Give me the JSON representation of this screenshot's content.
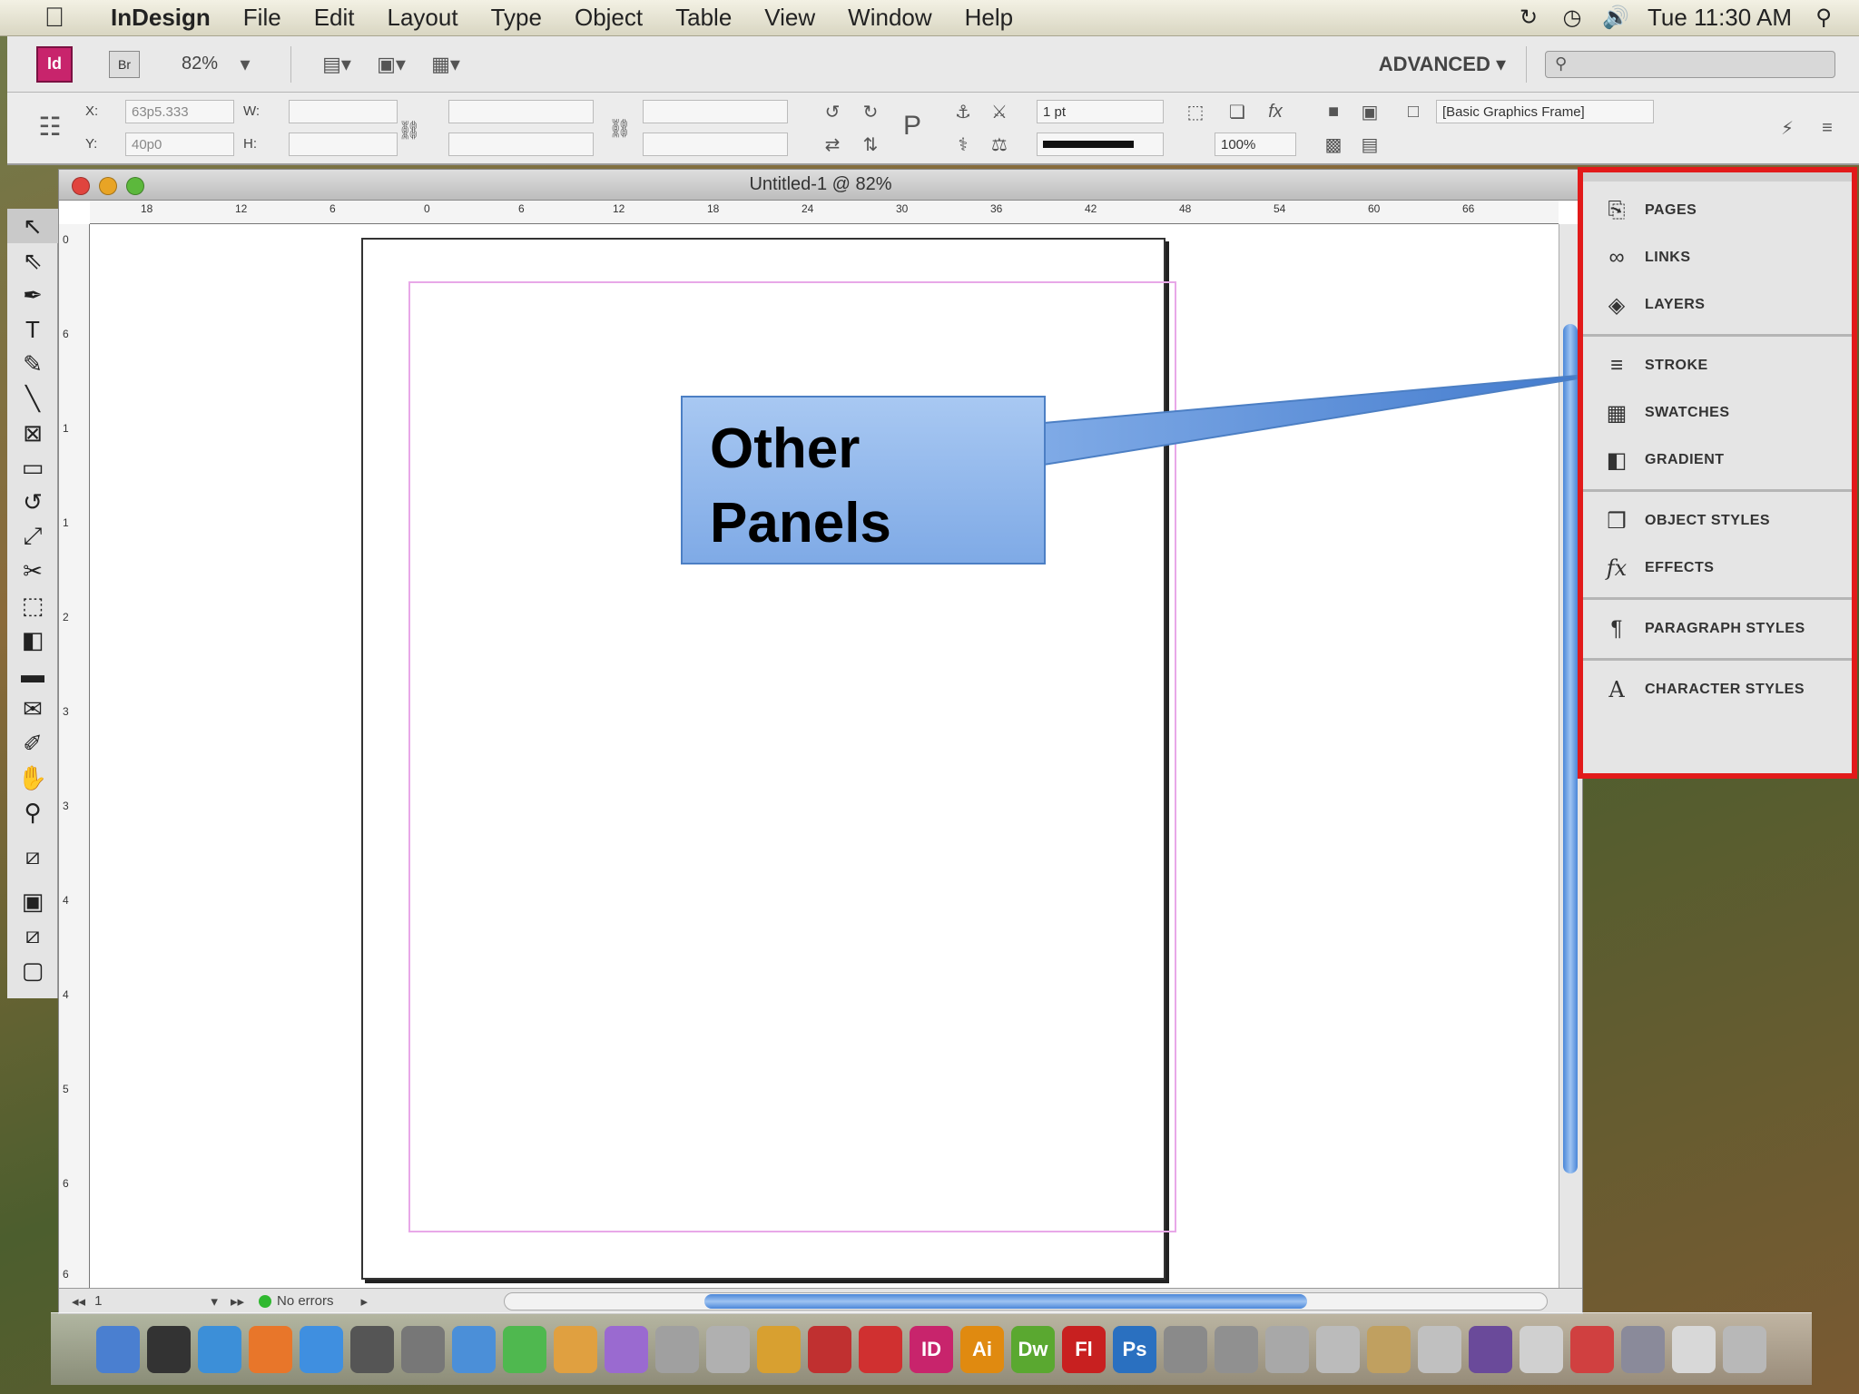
{
  "menubar": {
    "app": "InDesign",
    "items": [
      "File",
      "Edit",
      "Layout",
      "Type",
      "Object",
      "Table",
      "View",
      "Window",
      "Help"
    ],
    "clock": "Tue 11:30 AM"
  },
  "appbar": {
    "logo": "Id",
    "bridge": "Br",
    "zoom": "82%",
    "workspace": "ADVANCED"
  },
  "control": {
    "x_label": "X:",
    "x_value": "63p5.333",
    "y_label": "Y:",
    "y_value": "40p0",
    "w_label": "W:",
    "h_label": "H:",
    "stroke_weight": "1 pt",
    "scale_percent": "100%",
    "object_style": "[Basic Graphics Frame]"
  },
  "document": {
    "title": "Untitled-1 @ 82%",
    "page_number": "1",
    "preflight": "No errors",
    "ruler_h": [
      "18",
      "12",
      "6",
      "0",
      "6",
      "12",
      "18",
      "24",
      "30",
      "36",
      "42",
      "48",
      "54",
      "60",
      "66"
    ],
    "ruler_v": [
      "0",
      "6",
      "1",
      "1",
      "2",
      "3",
      "3",
      "4",
      "4",
      "5",
      "6",
      "6"
    ]
  },
  "callout": {
    "line1": "Other",
    "line2": "Panels",
    "colors": {
      "fill": "#8db5ec",
      "border": "#4c7fc4"
    }
  },
  "panels": {
    "groups": [
      [
        {
          "label": "PAGES",
          "icon": "pages-icon"
        },
        {
          "label": "LINKS",
          "icon": "links-icon"
        },
        {
          "label": "LAYERS",
          "icon": "layers-icon"
        }
      ],
      [
        {
          "label": "STROKE",
          "icon": "stroke-icon"
        },
        {
          "label": "SWATCHES",
          "icon": "swatches-icon"
        },
        {
          "label": "GRADIENT",
          "icon": "gradient-icon"
        }
      ],
      [
        {
          "label": "OBJECT STYLES",
          "icon": "object-styles-icon"
        },
        {
          "label": "EFFECTS",
          "icon": "effects-icon"
        }
      ],
      [
        {
          "label": "PARAGRAPH STYLES",
          "icon": "paragraph-styles-icon"
        }
      ],
      [
        {
          "label": "CHARACTER STYLES",
          "icon": "character-styles-icon"
        }
      ]
    ],
    "highlight_color": "#e21a1a"
  },
  "dock_apps": [
    {
      "name": "finder",
      "label": "",
      "color": "#4a7fd0"
    },
    {
      "name": "dashboard",
      "label": "",
      "color": "#333333"
    },
    {
      "name": "itunes",
      "label": "",
      "color": "#3c8fd8"
    },
    {
      "name": "firefox",
      "label": "",
      "color": "#e8762a"
    },
    {
      "name": "safari",
      "label": "",
      "color": "#3f8fe0"
    },
    {
      "name": "calculator",
      "label": "",
      "color": "#555555"
    },
    {
      "name": "system-prefs",
      "label": "",
      "color": "#777777"
    },
    {
      "name": "app-w",
      "label": "",
      "color": "#4b8fd8"
    },
    {
      "name": "app-h",
      "label": "",
      "color": "#4fb84f"
    },
    {
      "name": "app-paint",
      "label": "",
      "color": "#e0a040"
    },
    {
      "name": "app-purple",
      "label": "",
      "color": "#9a6ad0"
    },
    {
      "name": "app-table",
      "label": "",
      "color": "#a0a0a0"
    },
    {
      "name": "app-pencil",
      "label": "",
      "color": "#b0b0b0"
    },
    {
      "name": "app-burst",
      "label": "",
      "color": "#d8a030"
    },
    {
      "name": "acrobat",
      "label": "",
      "color": "#c03030"
    },
    {
      "name": "acrobat-reader",
      "label": "",
      "color": "#d03030"
    },
    {
      "name": "indesign",
      "label": "ID",
      "color": "#c8246c"
    },
    {
      "name": "illustrator",
      "label": "Ai",
      "color": "#e08a10"
    },
    {
      "name": "dreamweaver",
      "label": "Dw",
      "color": "#5aa830"
    },
    {
      "name": "flash",
      "label": "Fl",
      "color": "#c82020"
    },
    {
      "name": "photoshop",
      "label": "Ps",
      "color": "#2a70c0"
    },
    {
      "name": "app-printer",
      "label": "",
      "color": "#8a8a8a"
    },
    {
      "name": "app-network",
      "label": "",
      "color": "#909090"
    },
    {
      "name": "app-cross",
      "label": "",
      "color": "#a8a8a8"
    },
    {
      "name": "app-clip",
      "label": "",
      "color": "#bbbbbb"
    },
    {
      "name": "app-stamp",
      "label": "",
      "color": "#c0a060"
    },
    {
      "name": "app-sheet",
      "label": "",
      "color": "#c0c0c0"
    },
    {
      "name": "app-monitor",
      "label": "",
      "color": "#6a4a9a"
    },
    {
      "name": "app-doc",
      "label": "",
      "color": "#d0d0d0"
    },
    {
      "name": "app-pdf",
      "label": "",
      "color": "#d04040"
    },
    {
      "name": "app-stack",
      "label": "",
      "color": "#8a8a9a"
    },
    {
      "name": "app-note",
      "label": "",
      "color": "#d8d8d8"
    },
    {
      "name": "trash",
      "label": "",
      "color": "#b8b8b8"
    }
  ]
}
